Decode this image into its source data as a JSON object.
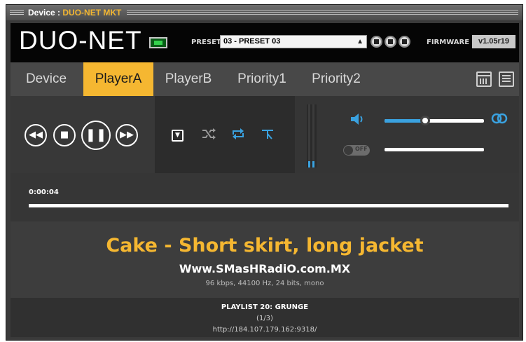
{
  "window": {
    "title_prefix": "Device : ",
    "device_name": "DUO-NET MKT"
  },
  "topbar": {
    "logo": "DUO-NET",
    "preset_label": "PRESET",
    "preset_value": "03 - PRESET 03",
    "firmware_label": "FIRMWARE",
    "firmware_value": "v1.05r19"
  },
  "tabs": [
    {
      "label": "Device",
      "active": false
    },
    {
      "label": "PlayerA",
      "active": true
    },
    {
      "label": "PlayerB",
      "active": false
    },
    {
      "label": "Priority1",
      "active": false
    },
    {
      "label": "Priority2",
      "active": false
    }
  ],
  "transport": {
    "previous_icon": "skip-previous-icon",
    "stop_icon": "stop-icon",
    "pause_icon": "pause-icon",
    "next_icon": "skip-next-icon"
  },
  "modes": {
    "dropdown_icon": "dropdown-icon",
    "shuffle_icon": "shuffle-icon",
    "repeat_icon": "repeat-icon",
    "fork_icon": "fork-icon"
  },
  "audio": {
    "volume": 0.41,
    "off_label": "OFF",
    "second_slider": 0.0
  },
  "vu": {
    "levels": [
      0.1,
      0.1
    ]
  },
  "playback": {
    "time": "0:00:04",
    "progress": 0.0
  },
  "nowplaying": {
    "song": "Cake - Short skirt, long jacket",
    "station": "Www.SMasHRadiO.com.MX",
    "format": "96 kbps, 44100 Hz, 24 bits, mono"
  },
  "playlist": {
    "name": "PLAYLIST 20: GRUNGE",
    "position": "(1/3)",
    "url": "http://184.107.179.162:9318/"
  },
  "colors": {
    "accent": "#f5b731",
    "blue": "#3aa2e0",
    "background": "#3a3a3a"
  }
}
